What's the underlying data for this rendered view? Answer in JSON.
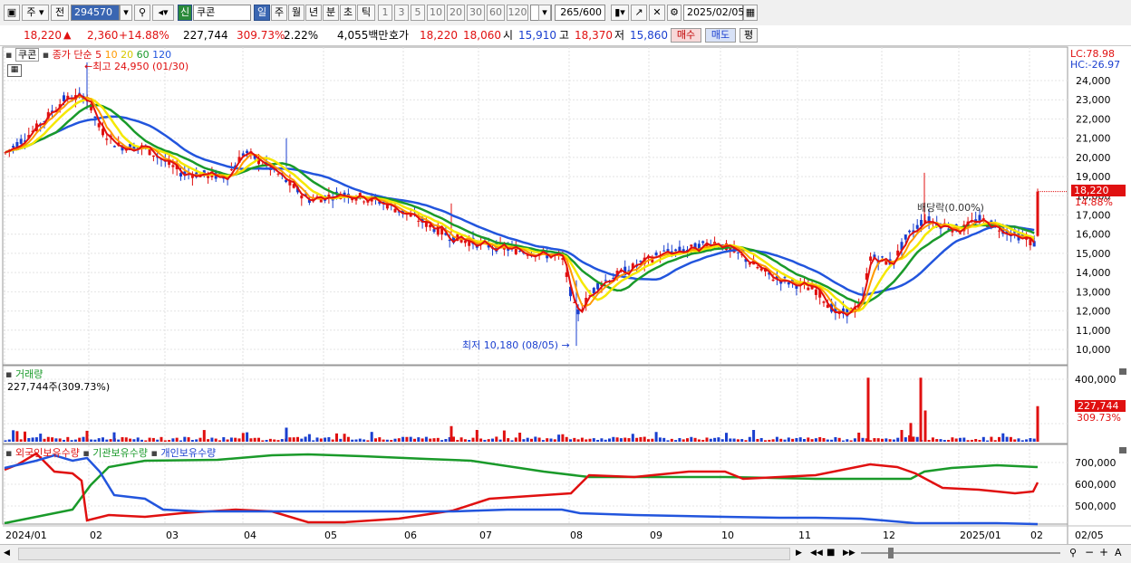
{
  "toolbar": {
    "market": "주",
    "prev": "전",
    "code": "294570",
    "badge": "신",
    "stock_name": "쿠콘",
    "periods": [
      "일",
      "주",
      "월",
      "년",
      "분",
      "초",
      "틱"
    ],
    "numbers": [
      "1",
      "3",
      "5",
      "10",
      "20",
      "30",
      "60",
      "120"
    ],
    "count": "265",
    "total": "/600",
    "date": "2025/02/05"
  },
  "quote": {
    "price": "18,220",
    "arrow": "▲",
    "change": "2,360",
    "change_pct": "+14.88%",
    "volume": "227,744",
    "vol_pct": "309.73%",
    "turnover_pct": "2.22%",
    "amount": "4,055백만",
    "bid_label": "호가",
    "ask": "18,220",
    "bid": "18,060",
    "open_label": "시",
    "open": "15,910",
    "high_label": "고",
    "high": "18,370",
    "low_label": "저",
    "low": "15,860",
    "buy": "매수",
    "sell": "매도",
    "avg": "평"
  },
  "price_panel": {
    "name": "쿠콘",
    "ma_label": "종가 단순",
    "ma_periods": [
      "5",
      "10",
      "20",
      "60",
      "120"
    ],
    "max_label": "최고 24,950 (01/30)",
    "min_label": "최저 10,180 (08/05)",
    "dividend": "배당락(0.00%)",
    "lc": "LC:78.98",
    "hc": "HC:-26.97",
    "last_price": "18,220",
    "last_pct": "14.88%",
    "yticks": [
      "24,000",
      "23,000",
      "22,000",
      "21,000",
      "20,000",
      "19,000",
      "18,000",
      "17,000",
      "16,000",
      "15,000",
      "14,000",
      "13,000",
      "12,000",
      "11,000",
      "10,000"
    ]
  },
  "volume_panel": {
    "title": "거래량",
    "subtitle": "227,744주(309.73%)",
    "yticks": [
      "400,000",
      "200,000"
    ],
    "last": "227,744",
    "last_pct": "309.73%"
  },
  "holding_panel": {
    "foreign": "외국인보유수량",
    "institution": "기관보유수량",
    "individual": "개인보유수량",
    "yticks": [
      "700,000",
      "600,000",
      "500,000"
    ]
  },
  "xaxis": [
    "2024/01",
    "02",
    "03",
    "04",
    "05",
    "06",
    "07",
    "08",
    "09",
    "10",
    "11",
    "12",
    "2025/01",
    "02"
  ],
  "xaxis_right": "02/05",
  "colors": {
    "ma5": "#e01010",
    "ma10": "#ff9900",
    "ma20": "#f5e800",
    "ma60": "#1a9a2a",
    "ma120": "#2255dd",
    "up": "#e01010",
    "down": "#1a3fcf"
  }
}
